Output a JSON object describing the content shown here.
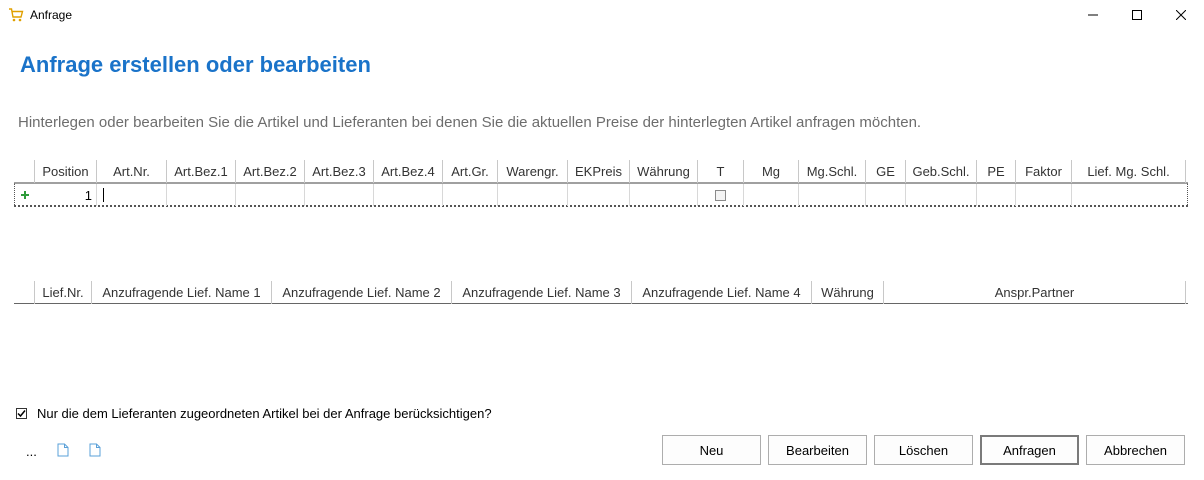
{
  "window": {
    "title": "Anfrage"
  },
  "heading": "Anfrage erstellen oder bearbeiten",
  "description": "Hinterlegen oder bearbeiten Sie die Artikel und Lieferanten bei denen Sie die aktuellen Preise der hinterlegten Artikel anfragen möchten.",
  "articles_grid": {
    "columns": [
      "Position",
      "Art.Nr.",
      "Art.Bez.1",
      "Art.Bez.2",
      "Art.Bez.3",
      "Art.Bez.4",
      "Art.Gr.",
      "Warengr.",
      "EKPreis",
      "Währung",
      "T",
      "Mg",
      "Mg.Schl.",
      "GE",
      "Geb.Schl.",
      "PE",
      "Faktor",
      "Lief. Mg. Schl."
    ],
    "rows": [
      {
        "position": "1"
      }
    ]
  },
  "suppliers_grid": {
    "columns": [
      "Lief.Nr.",
      "Anzufragende Lief. Name 1",
      "Anzufragende Lief. Name 2",
      "Anzufragende Lief. Name 3",
      "Anzufragende Lief. Name 4",
      "Währung",
      "Anspr.Partner"
    ]
  },
  "only_assigned_checkbox": {
    "label": "Nur die dem Lieferanten zugeordneten Artikel bei der Anfrage berücksichtigen?",
    "checked": true
  },
  "toolbar": {
    "ellipsis": "..."
  },
  "buttons": {
    "new": "Neu",
    "edit": "Bearbeiten",
    "delete": "Löschen",
    "request": "Anfragen",
    "cancel": "Abbrechen"
  },
  "colors": {
    "heading": "#1a73c9",
    "description": "#6d6d6d",
    "new_row_indicator": "#2e9c3a",
    "file_icon": "#5aa0d8"
  }
}
